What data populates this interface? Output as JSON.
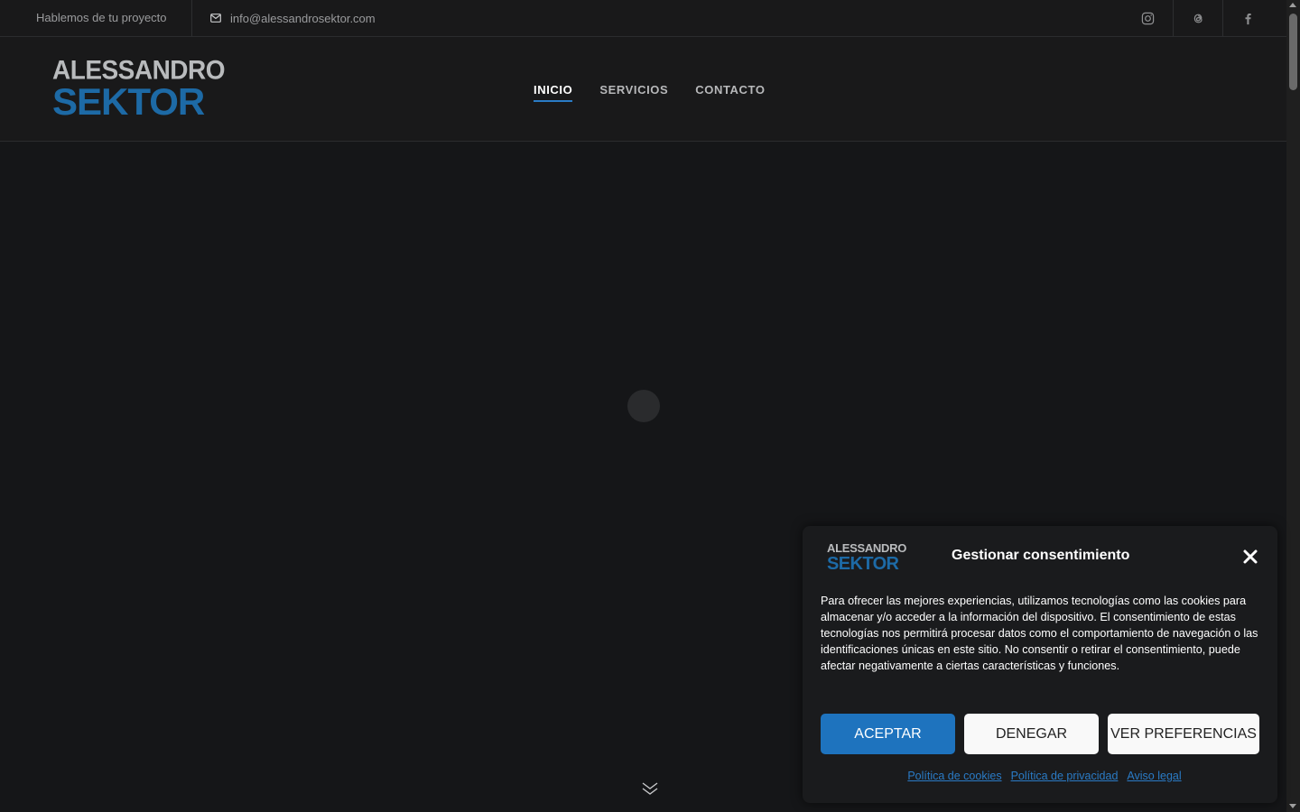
{
  "topbar": {
    "tagline": "Hablemos de tu proyecto",
    "email": "info@alessandrosektor.com",
    "social": [
      "instagram-icon",
      "threads-icon",
      "facebook-icon"
    ]
  },
  "header": {
    "logo_line1": "ALESSANDRO",
    "logo_line2": "SEKTOR",
    "nav": [
      {
        "label": "INICIO",
        "active": true
      },
      {
        "label": "SERVICIOS",
        "active": false
      },
      {
        "label": "CONTACTO",
        "active": false
      }
    ]
  },
  "consent": {
    "logo_line1": "ALESSANDRO",
    "logo_line2": "SEKTOR",
    "title": "Gestionar consentimiento",
    "text": "Para ofrecer las mejores experiencias, utilizamos tecnologías como las cookies para almacenar y/o acceder a la información del dispositivo. El consentimiento de estas tecnologías nos permitirá procesar datos como el comportamiento de navegación o las identificaciones únicas en este sitio. No consentir o retirar el consentimiento, puede afectar negativamente a ciertas características y funciones.",
    "accept_label": "ACEPTAR",
    "deny_label": "DENEGAR",
    "prefs_label": "VER PREFERENCIAS",
    "links": {
      "cookies": "Política de cookies",
      "privacy": "Política de privacidad",
      "legal": "Aviso legal"
    }
  },
  "colors": {
    "accent": "#1e73be",
    "background": "#151618",
    "brand_blue": "#1d6aa6"
  }
}
